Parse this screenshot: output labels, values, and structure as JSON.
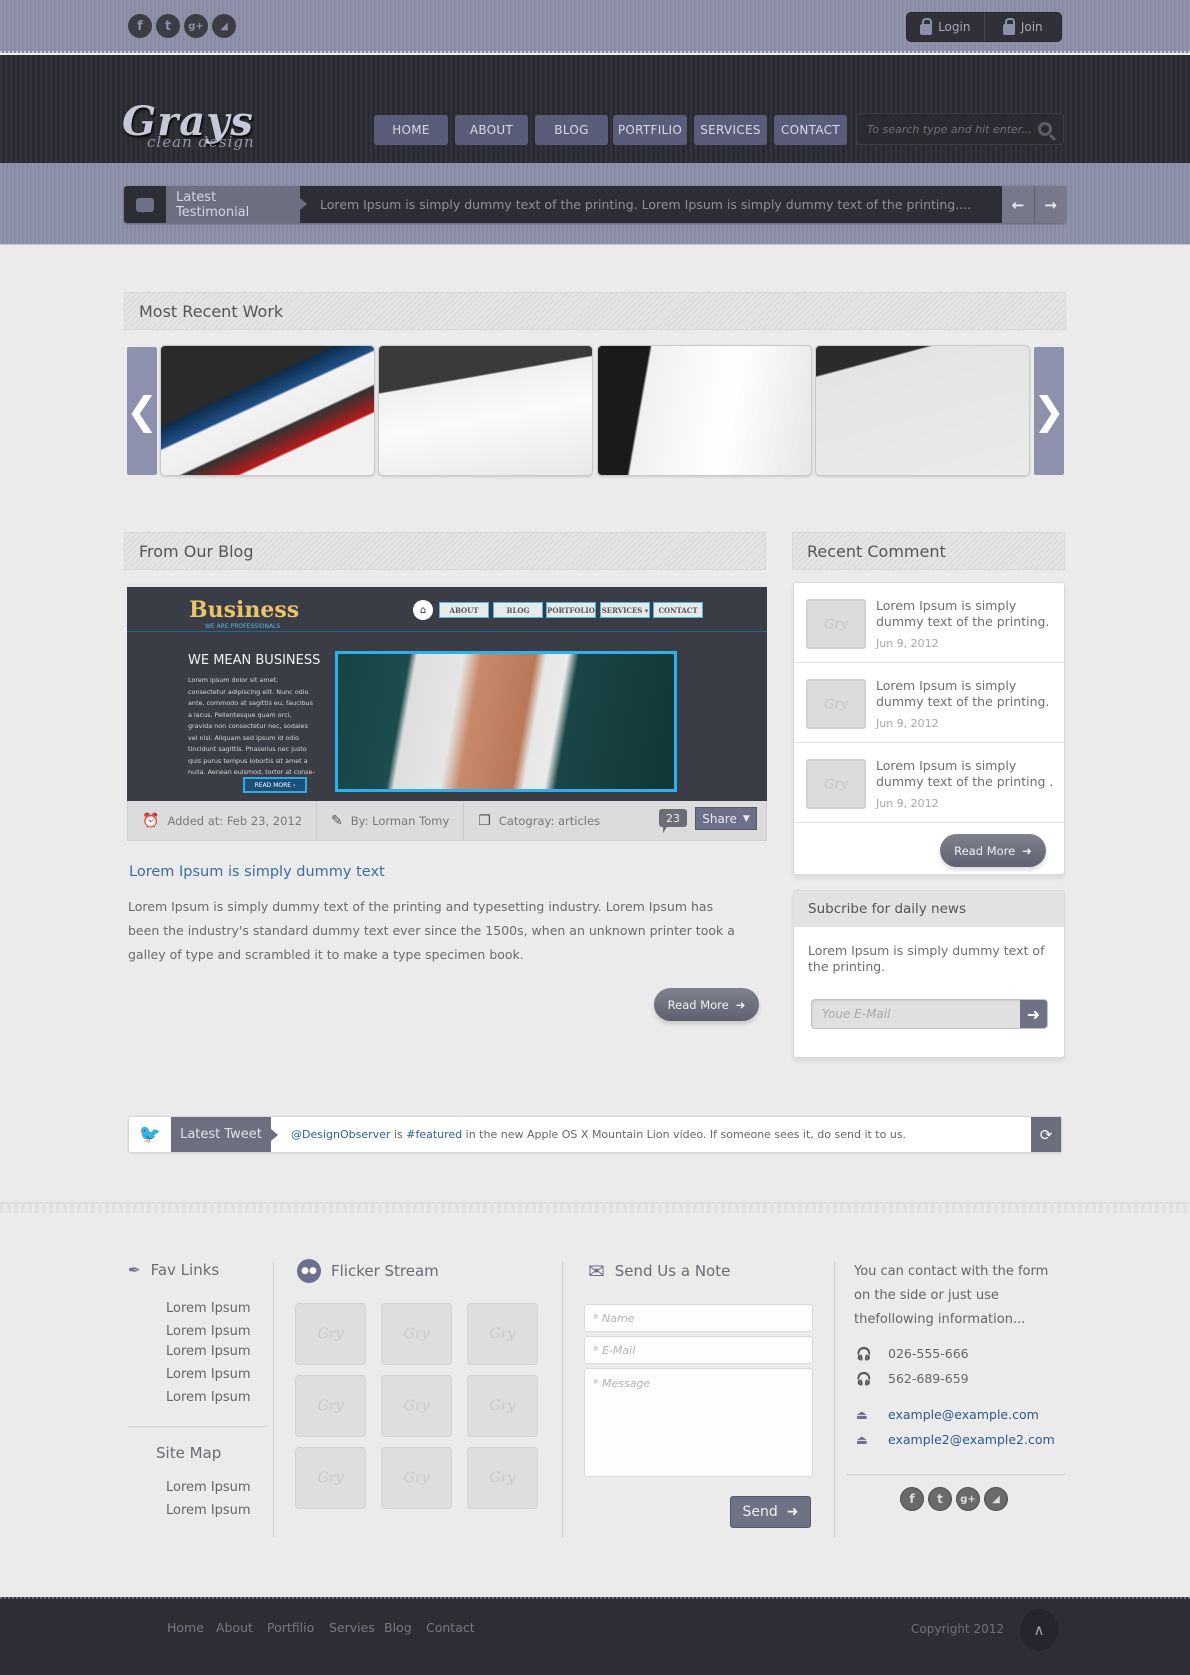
{
  "topbar": {
    "social": [
      {
        "icon": "facebook-icon",
        "glyph": "f"
      },
      {
        "icon": "twitter-icon",
        "glyph": "t"
      },
      {
        "icon": "google-plus-icon",
        "glyph": "g+"
      },
      {
        "icon": "rss-icon",
        "glyph": "◢"
      }
    ],
    "login_label": "Login",
    "join_label": "Join"
  },
  "header": {
    "logo_title": "Grays",
    "logo_subtitle": "clean design",
    "nav": [
      "HOME",
      "ABOUT",
      "BLOG",
      "PORTFILIO",
      "SERVICES",
      "CONTACT"
    ],
    "search_placeholder": "To search type and hit enter..."
  },
  "testimonial": {
    "label": "Latest Testimonial",
    "text": "Lorem Ipsum is simply dummy text of the printing. Lorem Ipsum is simply dummy text of the printing....",
    "prev": "←",
    "next": "→"
  },
  "recent_work": {
    "title": "Most Recent Work",
    "prev": "❮",
    "next": "❯",
    "thumbs": [
      "Portfolio item 1",
      "Portfolio item 2",
      "Portfolio item 3",
      "Portfolio item 4"
    ]
  },
  "blog": {
    "title": "From Our Blog",
    "preview": {
      "brand": "Business",
      "brand_sub": "WE ARE PROFESSIONALS",
      "home_glyph": "⌂",
      "nav": [
        "ABOUT",
        "BLOG",
        "PORTFOLIO",
        "SERVICES ▾",
        "CONTACT"
      ],
      "headline": "WE MEAN BUSINESS",
      "body": "Lorem ipsum dolor sit amet, consectetur adipiscing elit. Nunc odio ante, commodo at sagittis eu, faucibus a lacus. Pellentesque quam orci, gravida non consectetur nec, sodales vel nisl. Aliquam sed ipsum id odio tincidunt sagittis. Phasellus nec justo quis purus tempus lobortis sit amet a nulla. Aenean euismod, tortor at conse-",
      "button": "READ MORE ›"
    },
    "meta": {
      "date": "Added at: Feb 23, 2012",
      "author": "By: Lorman Tomy",
      "category": "Catogray: articles",
      "comments": "23",
      "share": "Share"
    },
    "post_title": "Lorem Ipsum is simply dummy text",
    "post_body": "Lorem Ipsum is simply dummy text of the printing and typesetting industry. Lorem Ipsum has been the industry's standard dummy text ever since the 1500s, when an unknown printer took a galley of type and scrambled it to make a type specimen book.",
    "read_more": "Read More"
  },
  "recent_comment": {
    "title": "Recent Comment",
    "items": [
      {
        "text": "Lorem Ipsum is simply dummy text of the printing.",
        "date": "Jun 9, 2012"
      },
      {
        "text": "Lorem Ipsum is simply dummy text of the printing.",
        "date": "Jun 9, 2012"
      },
      {
        "text": "Lorem Ipsum is simply dummy text of the printing .",
        "date": "Jun 9, 2012"
      }
    ],
    "avatar_glyph": "Gry",
    "read_more": "Read More"
  },
  "subscribe": {
    "title": "Subcribe for daily news",
    "text": "Lorem Ipsum is simply dummy text of the printing.",
    "placeholder": "Youe E-Mail"
  },
  "tweet": {
    "label": "Latest Tweet",
    "handle": "@DesignObserver",
    "mid": " is ",
    "hashtag": "#featured",
    "rest": " in the new Apple OS X Mountain Lion video. If someone sees it, do send it to us."
  },
  "footer": {
    "fav_title": "Fav Links",
    "fav_links": [
      "Lorem Ipsum",
      "Lorem Ipsum",
      "Lorem Ipsum",
      "Lorem Ipsum",
      "Lorem Ipsum"
    ],
    "sitemap_title": "Site Map",
    "sitemap_links": [
      "Lorem Ipsum",
      "Lorem Ipsum"
    ],
    "flickr_title": "Flicker Stream",
    "flickr_glyph": "Gry",
    "note_title": "Send Us a Note",
    "name_placeholder": "* Name",
    "email_placeholder": "* E-Mail",
    "message_placeholder": "* Message",
    "send": "Send",
    "contact_intro": "You can contact with the form on the side or just use thefollowing information...",
    "phones": [
      "026-555-666",
      "562-689-659"
    ],
    "emails": [
      "example@example.com",
      "example2@example2.com"
    ],
    "bottom_nav": [
      "Home",
      "About",
      "Portfilio",
      "Servies",
      "Blog",
      "Contact"
    ],
    "copyright": "Copyright 2012",
    "to_top": "∧"
  },
  "colors": {
    "accent": "#8c8fa9",
    "dark": "#2d2e35",
    "link": "#2c6096"
  }
}
